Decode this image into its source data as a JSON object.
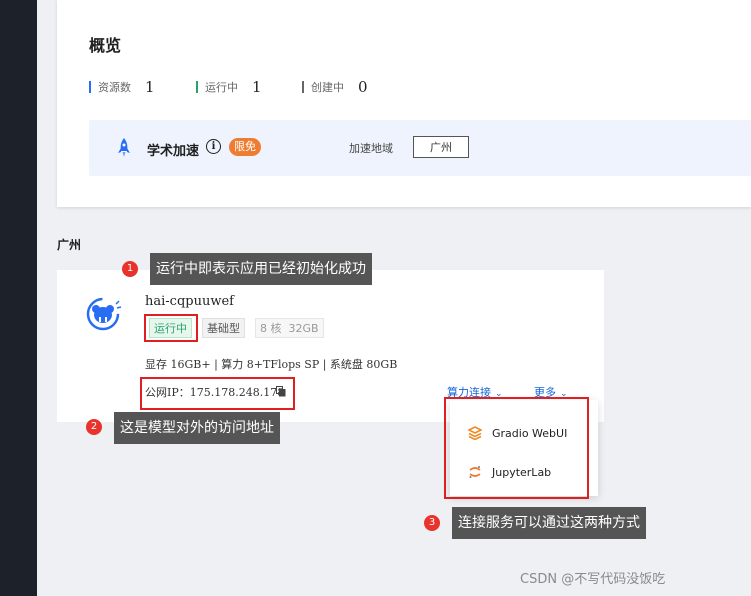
{
  "overview": {
    "title": "概览",
    "stats": [
      {
        "label": "资源数",
        "value": "1",
        "color": "#2a6df5"
      },
      {
        "label": "运行中",
        "value": "1",
        "color": "#29a36a"
      },
      {
        "label": "创建中",
        "value": "0",
        "color": "#666666"
      }
    ]
  },
  "academic": {
    "title": "学术加速",
    "badge": "限免",
    "region_label": "加速地域",
    "region_value": "广州"
  },
  "region_section": {
    "title": "广州"
  },
  "instance": {
    "name": "hai-cqpuuwef",
    "status": "运行中",
    "type": "基础型",
    "cores": "8 核",
    "memory": "32GB",
    "specs": "显存 16GB+ | 算力 8+TFlops SP | 系统盘 80GB",
    "ip": "公网IP：175.178.248.178",
    "connect_label": "算力连接",
    "more_label": "更多"
  },
  "connect_menu": {
    "items": [
      {
        "label": "Gradio WebUI"
      },
      {
        "label": "JupyterLab"
      }
    ]
  },
  "annotations": [
    {
      "num": "1",
      "text": "运行中即表示应用已经初始化成功"
    },
    {
      "num": "2",
      "text": "这是模型对外的访问地址"
    },
    {
      "num": "3",
      "text": "连接服务可以通过这两种方式"
    }
  ],
  "watermark": "CSDN @不写代码没饭吃",
  "colors": {
    "accent": "#1565d8",
    "callout_red": "#e8322b",
    "running_green": "#29a36a"
  }
}
